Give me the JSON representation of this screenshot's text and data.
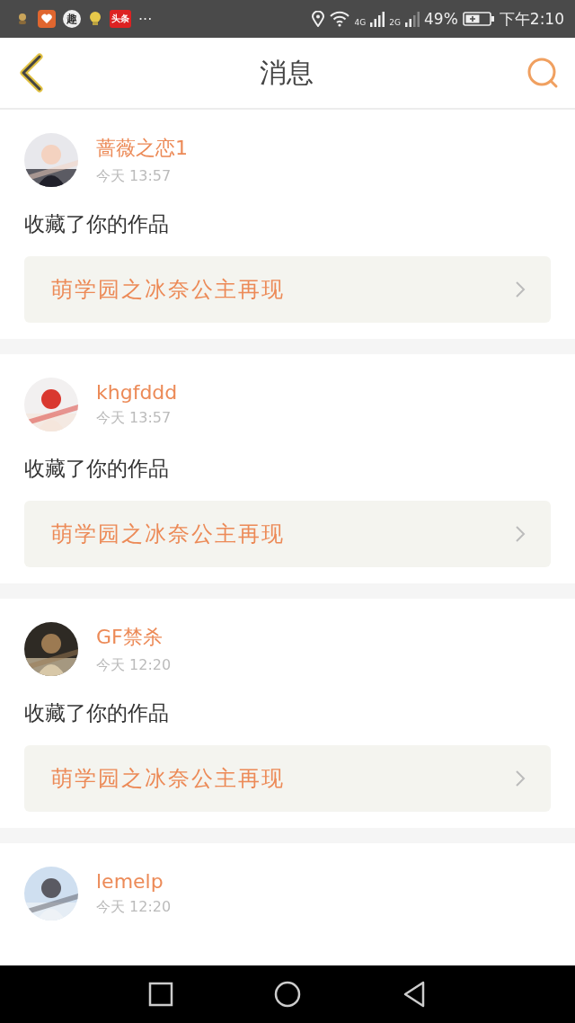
{
  "status_bar": {
    "app_icons": [
      {
        "kind": "figure"
      },
      {
        "kind": "heart"
      },
      {
        "kind": "round",
        "text": "趣"
      },
      {
        "kind": "bulb"
      },
      {
        "kind": "news",
        "text": "头条"
      }
    ],
    "more": "···",
    "network_1": "4G",
    "network_2": "2G",
    "battery": "49%",
    "time": "下午2:10"
  },
  "header": {
    "title": "消息"
  },
  "messages": [
    {
      "name": "蔷薇之恋1",
      "time": "今天  13:57",
      "action": "收藏了你的作品",
      "work_title": "萌学园之冰奈公主再现"
    },
    {
      "name": "khgfddd",
      "time": "今天  13:57",
      "action": "收藏了你的作品",
      "work_title": "萌学园之冰奈公主再现"
    },
    {
      "name": "GF禁杀",
      "time": "今天  12:20",
      "action": "收藏了你的作品",
      "work_title": "萌学园之冰奈公主再现"
    },
    {
      "name": "lemelp",
      "time": "今天  12:20"
    }
  ]
}
